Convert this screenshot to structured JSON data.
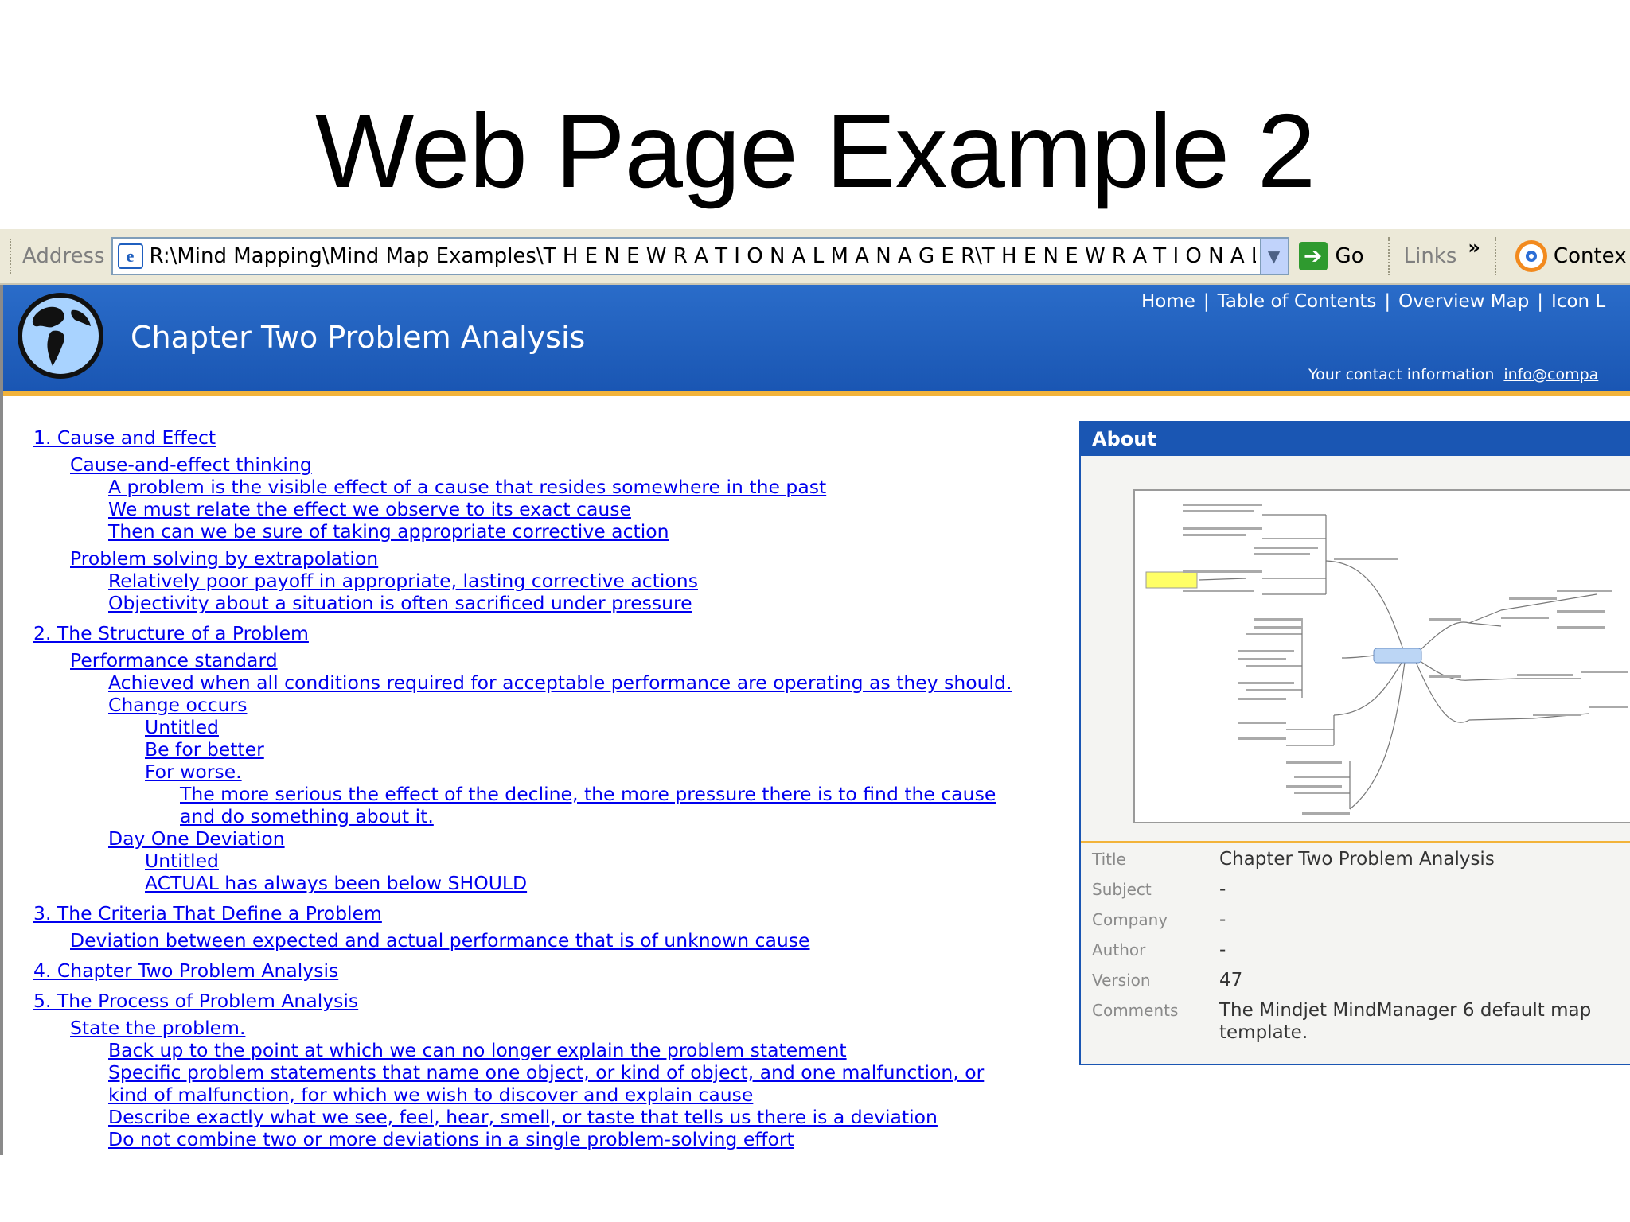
{
  "slide": {
    "title": "Web Page Example 2"
  },
  "browser": {
    "address_label": "Address",
    "address_value": "R:\\Mind Mapping\\Mind Map Examples\\T H E  N E W  R A T I O N A L  M A N A G E R\\T H E  N E W R A T I O N A L",
    "go_label": "Go",
    "links_label": "Links",
    "links_more": "»",
    "context_label": "Contex"
  },
  "banner": {
    "title": "Chapter Two Problem Analysis",
    "nav": [
      "Home",
      "Table of Contents",
      "Overview Map",
      "Icon L"
    ],
    "nav_sep": "|",
    "contact_label": "Your contact information",
    "contact_email": "info@compa"
  },
  "outline": [
    {
      "level": 0,
      "text": "1. Cause and Effect"
    },
    {
      "level": 1,
      "text": "Cause-and-effect thinking"
    },
    {
      "level": 2,
      "text": "A problem is the visible effect of a cause that resides somewhere in the past"
    },
    {
      "level": 2,
      "text": "We must relate the effect we observe to its exact cause"
    },
    {
      "level": 2,
      "text": "Then can we be sure of taking appropriate corrective action"
    },
    {
      "level": 1,
      "text": "Problem solving by extrapolation"
    },
    {
      "level": 2,
      "text": "Relatively poor payoff in appropriate, lasting corrective actions"
    },
    {
      "level": 2,
      "text": "Objectivity about a situation is often sacrificed under pressure"
    },
    {
      "level": 0,
      "text": "2. The Structure of a Problem"
    },
    {
      "level": 1,
      "text": "Performance standard"
    },
    {
      "level": 2,
      "text": "Achieved when all conditions required for acceptable performance are operating as they should."
    },
    {
      "level": 2,
      "text": "Change occurs"
    },
    {
      "level": 3,
      "text": "Untitled"
    },
    {
      "level": 3,
      "text": "Be for better"
    },
    {
      "level": 3,
      "text": "For worse."
    },
    {
      "level": 4,
      "text": "The more serious the effect of the decline, the more pressure there is to find the cause"
    },
    {
      "level": 4,
      "text": "and do something about it."
    },
    {
      "level": 2,
      "text": "Day One Deviation"
    },
    {
      "level": 3,
      "text": "Untitled"
    },
    {
      "level": 3,
      "text": "ACTUAL has always been below SHOULD"
    },
    {
      "level": 0,
      "text": "3. The Criteria That Define a Problem"
    },
    {
      "level": 1,
      "text": "Deviation between expected and actual performance that is of unknown cause"
    },
    {
      "level": 0,
      "text": "4. Chapter Two Problem Analysis"
    },
    {
      "level": 0,
      "text": "5. The Process of Problem Analysis"
    },
    {
      "level": 1,
      "text": "State the problem."
    },
    {
      "level": 2,
      "text": "Back up to the point at which we can no longer explain the problem statement"
    },
    {
      "level": 2,
      "text": "Specific problem statements that name one object, or kind of object, and one malfunction, or"
    },
    {
      "level": 2,
      "text": "kind of malfunction, for which we wish to discover and explain cause"
    },
    {
      "level": 2,
      "text": "Describe exactly what we see, feel, hear, smell, or taste that tells us there is a deviation"
    },
    {
      "level": 2,
      "text": "Do not combine two or more deviations in a single problem-solving effort"
    }
  ],
  "about": {
    "heading": "About",
    "properties": [
      {
        "key": "Title",
        "value": "Chapter Two Problem Analysis"
      },
      {
        "key": "Subject",
        "value": "-"
      },
      {
        "key": "Company",
        "value": "-"
      },
      {
        "key": "Author",
        "value": "-"
      },
      {
        "key": "Version",
        "value": "47"
      },
      {
        "key": "Comments",
        "value": "The Mindjet MindManager 6 default map template."
      }
    ]
  },
  "colors": {
    "banner_blue": "#1a56b3",
    "accent_orange": "#f2b33a",
    "link": "#0000ee"
  }
}
